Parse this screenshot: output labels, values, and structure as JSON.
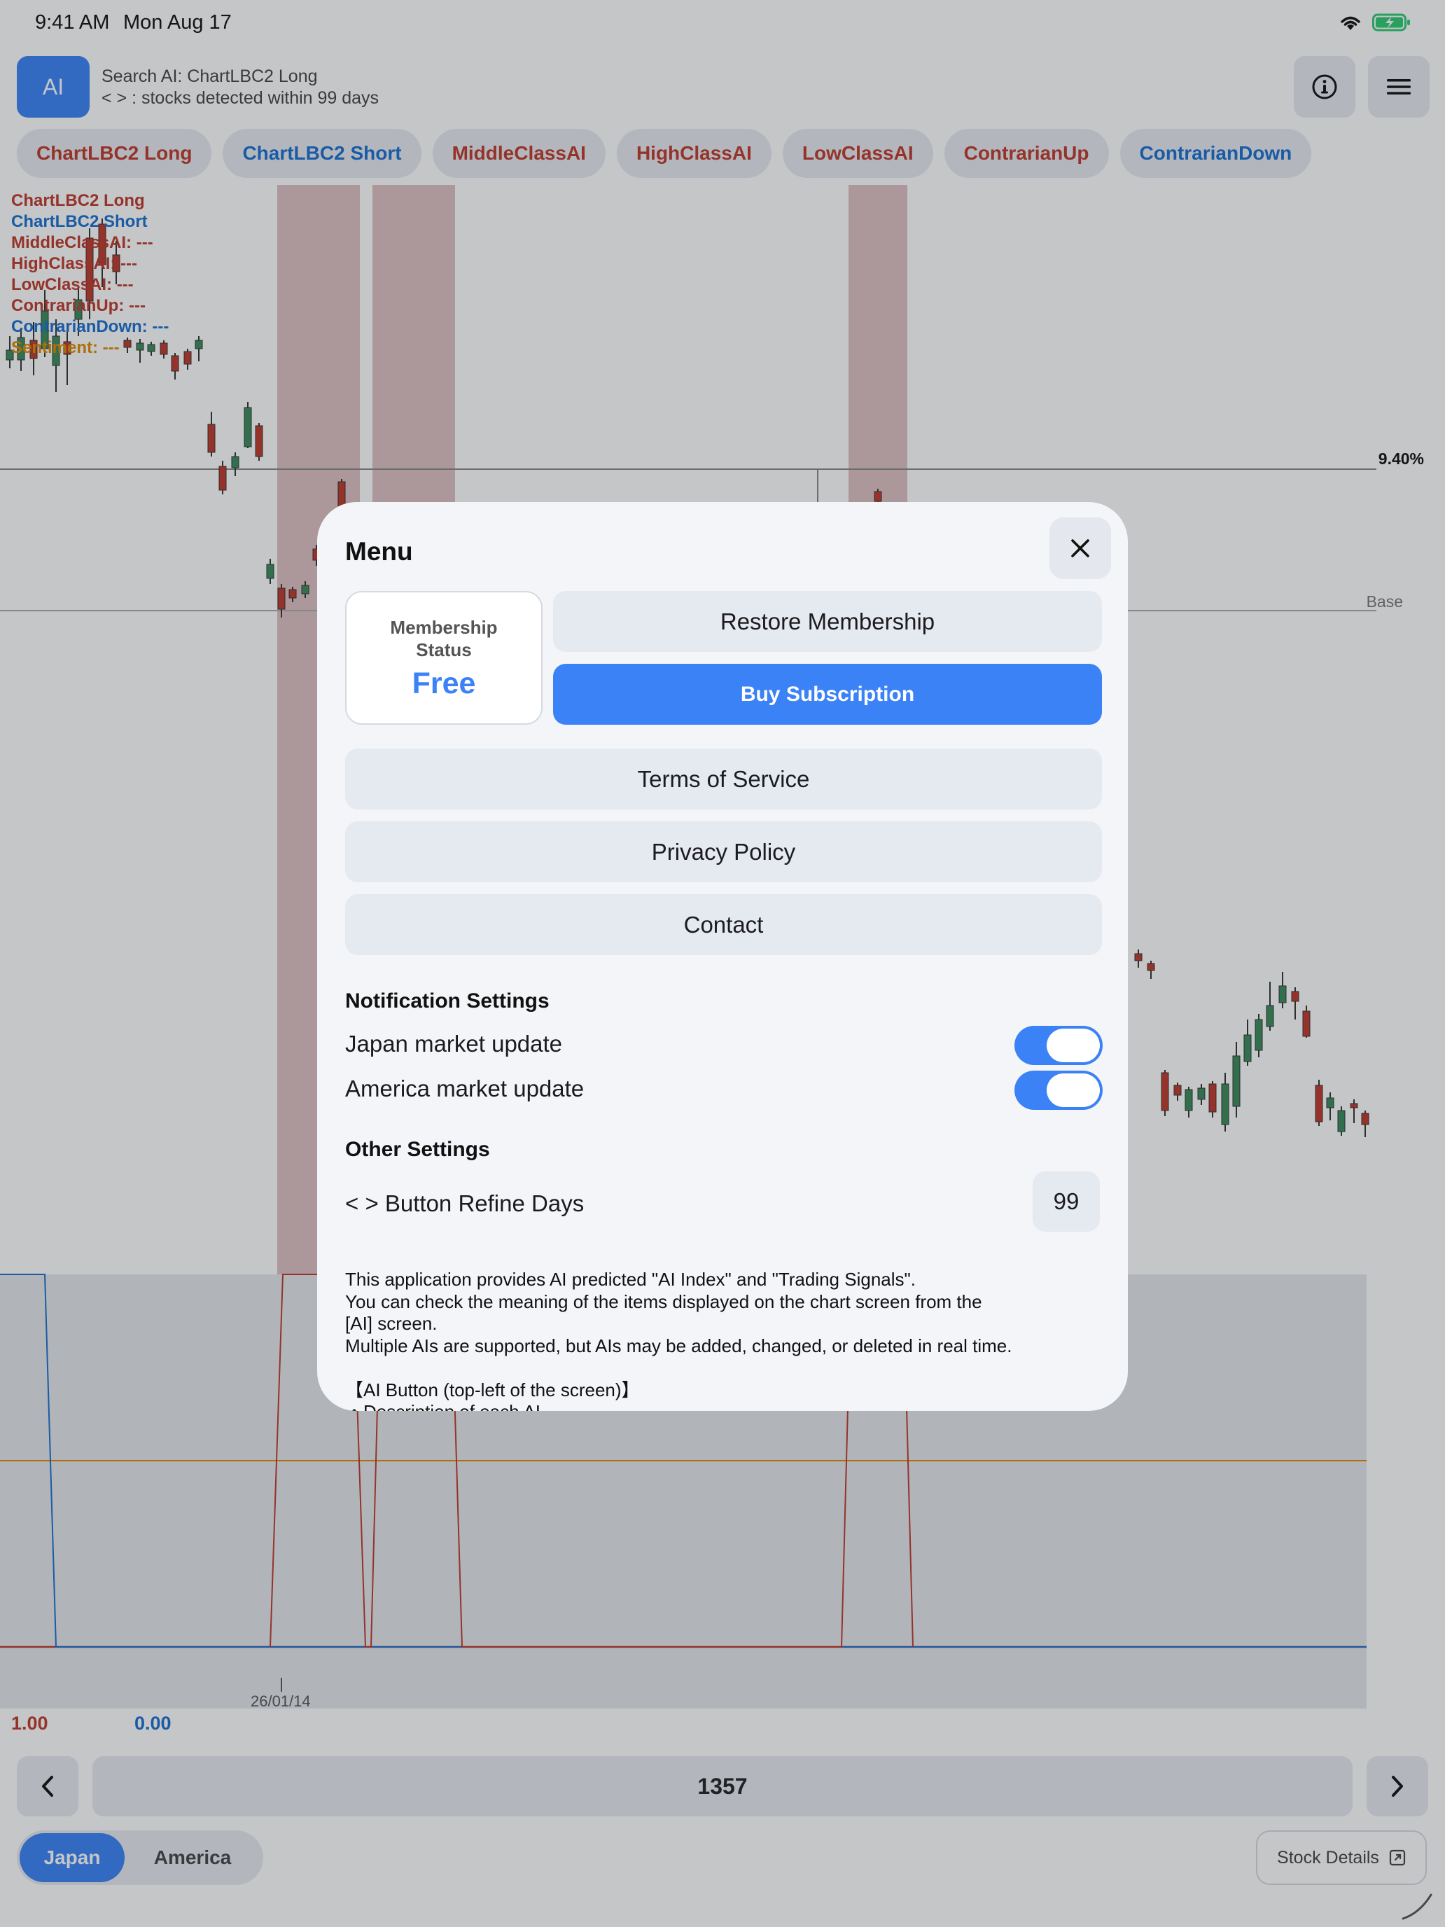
{
  "status_bar": {
    "time": "9:41 AM",
    "date": "Mon Aug 17"
  },
  "header": {
    "ai_button": "AI",
    "search_line": "Search AI: ChartLBC2 Long",
    "detect_line": "< > : stocks detected within 99 days"
  },
  "chips": [
    {
      "label": "ChartLBC2 Long",
      "color": "red"
    },
    {
      "label": "ChartLBC2 Short",
      "color": "blue"
    },
    {
      "label": "MiddleClassAI",
      "color": "red"
    },
    {
      "label": "HighClassAI",
      "color": "red"
    },
    {
      "label": "LowClassAI",
      "color": "red"
    },
    {
      "label": "ContrarianUp",
      "color": "red"
    },
    {
      "label": "ContrarianDown",
      "color": "blue"
    }
  ],
  "legend": [
    {
      "text": "ChartLBC2 Long",
      "color": "red"
    },
    {
      "text": "ChartLBC2 Short",
      "color": "blue"
    },
    {
      "text": "MiddleClassAI: ---",
      "color": "red"
    },
    {
      "text": "HighClassAI: ---",
      "color": "red"
    },
    {
      "text": "LowClassAI: ---",
      "color": "red"
    },
    {
      "text": "ContrarianUp: ---",
      "color": "red"
    },
    {
      "text": "ContrarianDown: ---",
      "color": "blue"
    },
    {
      "text": "Sentiment: ---",
      "color": "orange"
    }
  ],
  "chart_labels": {
    "pct": "9.40%",
    "base": "Base",
    "date": "26/01/14",
    "value_left": "1.00",
    "value_right": "0.00"
  },
  "bottom": {
    "count": "1357",
    "market_japan": "Japan",
    "market_america": "America",
    "stock_details": "Stock Details"
  },
  "menu": {
    "title": "Menu",
    "membership_label": "Membership Status",
    "membership_value": "Free",
    "restore": "Restore Membership",
    "buy": "Buy Subscription",
    "terms": "Terms of Service",
    "privacy": "Privacy Policy",
    "contact": "Contact",
    "notification_heading": "Notification Settings",
    "japan_update": "Japan market update",
    "america_update": "America market update",
    "japan_update_on": true,
    "america_update_on": true,
    "other_heading": "Other Settings",
    "refine_days_label": "< > Button Refine Days",
    "refine_days_value": "99",
    "description": [
      "This application provides AI predicted \"AI Index\" and \"Trading Signals\".",
      "You can check the meaning of the items displayed on the chart screen from the",
      "[AI] screen.",
      "Multiple AIs are supported, but AIs may be added, changed, or deleted in real time.",
      "",
      "【AI Button (top-left of the screen)】",
      "・Description of each AI"
    ]
  },
  "colors": {
    "accent": "#3b82f6",
    "red": "#c0392b",
    "blue": "#1a6fd0",
    "orange": "#e08a00",
    "candle_up": "#3a8a5a",
    "candle_down": "#c0392b",
    "signal_band": "#c49090"
  }
}
